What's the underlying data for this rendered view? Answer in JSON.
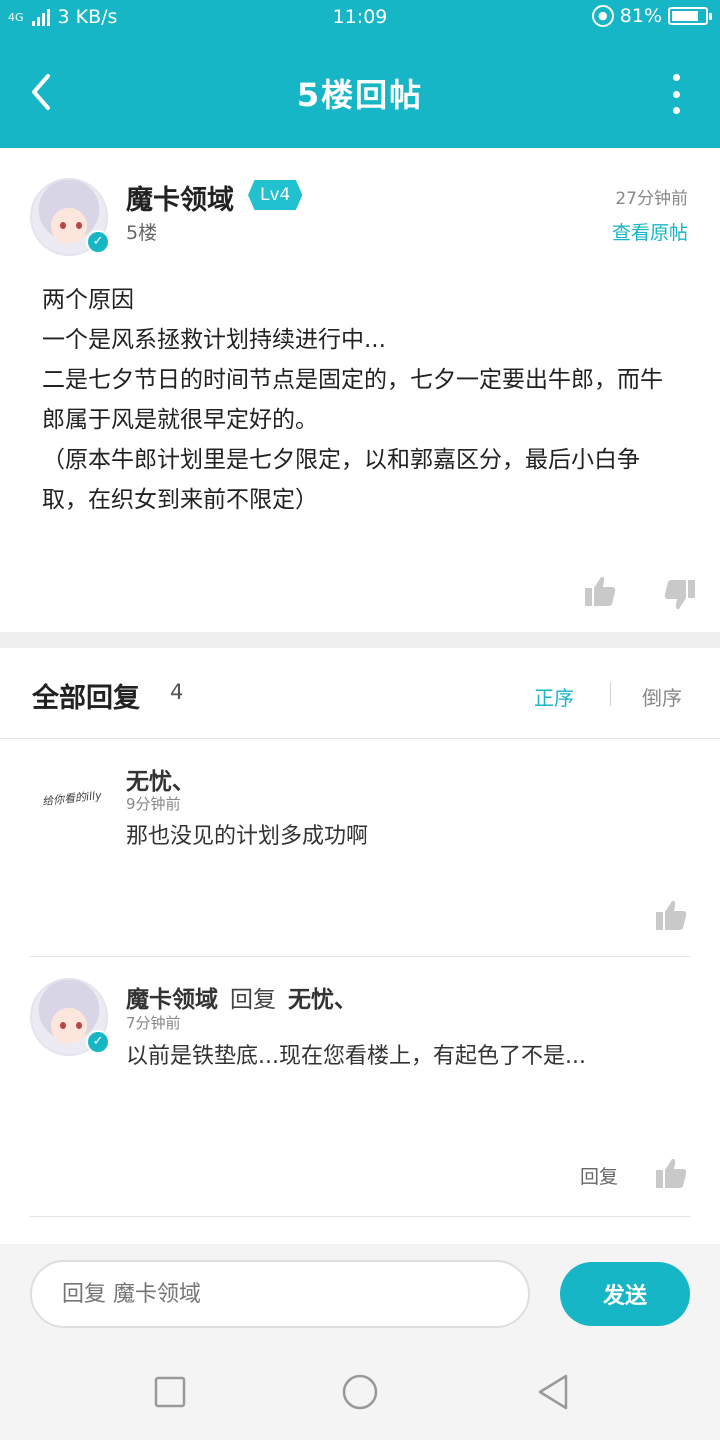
{
  "status_bar": {
    "network": "4G",
    "speed": "3 KB/s",
    "time": "11:09",
    "battery": "81%",
    "battery_level": 0.81
  },
  "header": {
    "title": "5楼回帖",
    "back_icon": "chevron-left-icon",
    "more_icon": "more-vertical-icon"
  },
  "post": {
    "author": "魔卡领域",
    "level": "Lv4",
    "floor": "5楼",
    "time": "27分钟前",
    "view_original": "查看原帖",
    "body": [
      "两个原因",
      "一个是风系拯救计划持续进行中...",
      "二是七夕节日的时间节点是固定的，七夕一定要出牛郎，而牛郎属于风是就很早定好的。",
      "（原本牛郎计划里是七夕限定，以和郭嘉区分，最后小白争取，在织女到来前不限定）"
    ],
    "like_icon": "thumbs-up-icon",
    "dislike_icon": "thumbs-down-icon"
  },
  "replies": {
    "title": "全部回复",
    "count": "4",
    "sort_asc": "正序",
    "sort_desc": "倒序",
    "items": [
      {
        "name": "无忧、",
        "time": "9分钟前",
        "text": "那也没见的计划多成功啊",
        "avatar_text": "给你看的illy"
      },
      {
        "name": "魔卡领域",
        "reply_word": "回复",
        "reply_to": "无忧、",
        "time": "7分钟前",
        "text": "以前是铁垫底...现在您看楼上，有起色了不是...",
        "reply_label": "回复"
      }
    ]
  },
  "composer": {
    "placeholder": "回复 魔卡领域",
    "send_label": "发送"
  },
  "colors": {
    "brand": "#17b6c6",
    "text": "#222222",
    "muted": "#888888"
  }
}
